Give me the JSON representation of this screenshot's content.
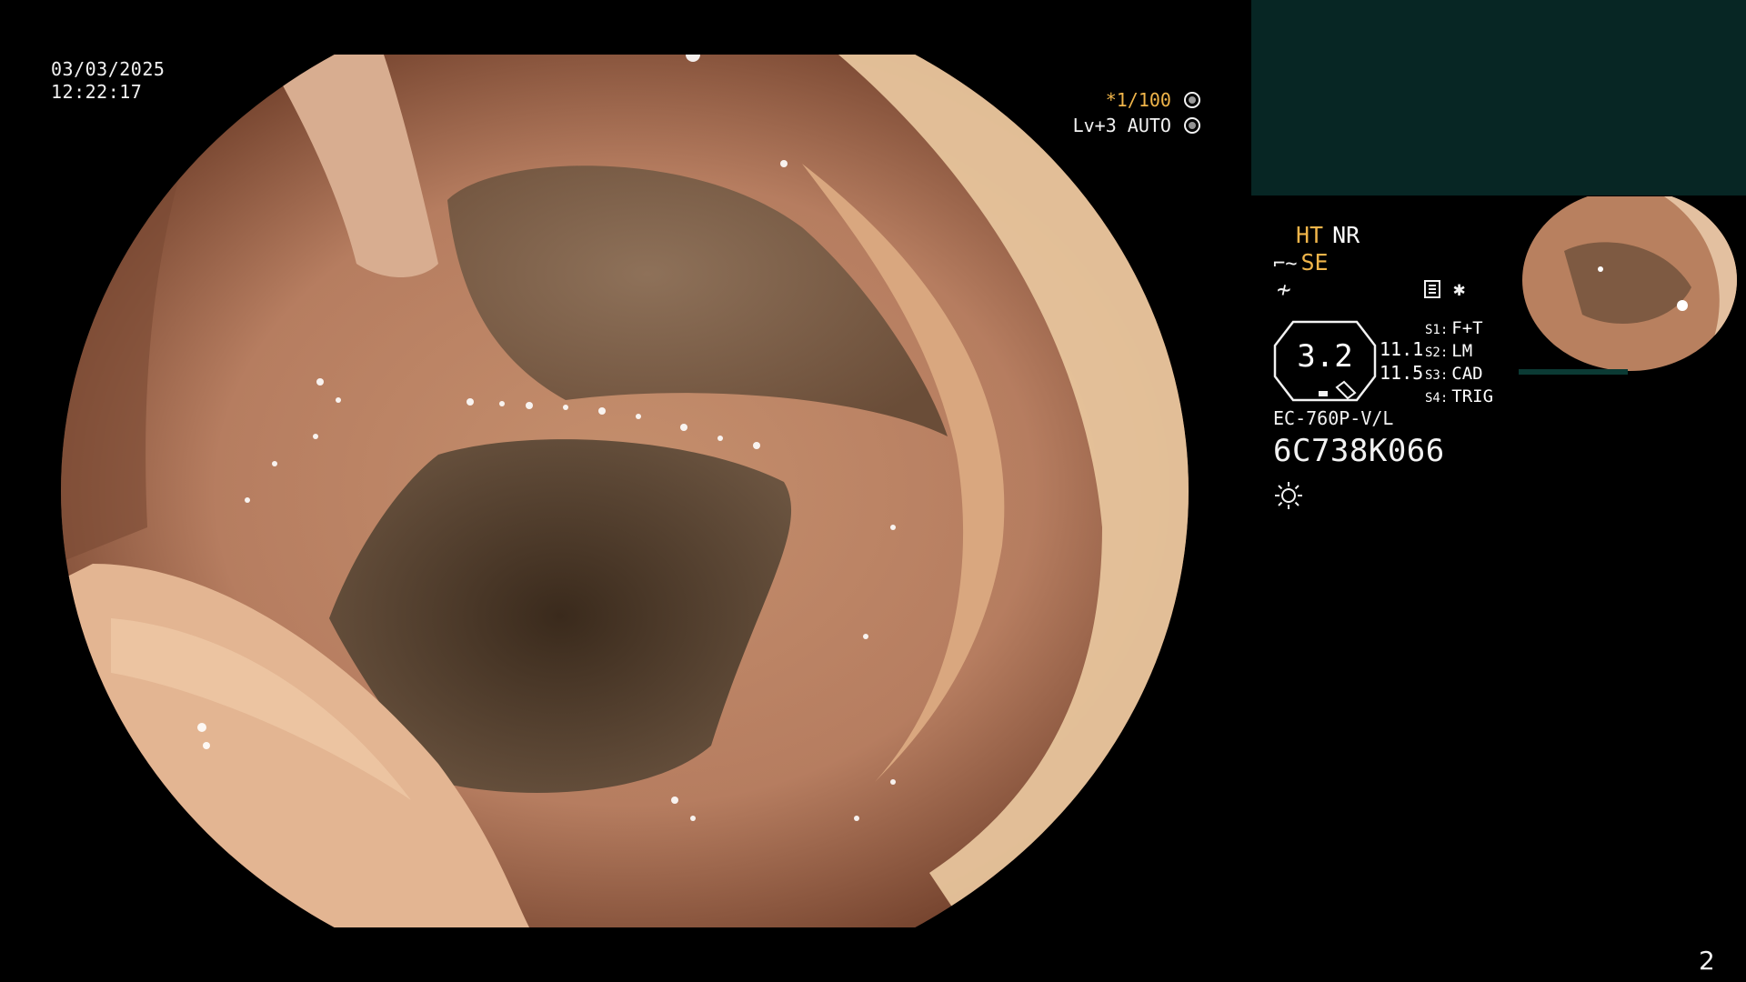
{
  "overlay": {
    "date": "03/03/2025",
    "time": "12:22:17",
    "shutter": "*1/100",
    "level": "Lv+3 AUTO"
  },
  "info": {
    "ht": "HT",
    "nr": "NR",
    "se": "SE",
    "magnification": "3.2",
    "value1": "11.1",
    "value2": "11.5",
    "switches": [
      {
        "key": "S1:",
        "label": "F+T"
      },
      {
        "key": "S2:",
        "label": "LM"
      },
      {
        "key": "S3:",
        "label": "CAD"
      },
      {
        "key": "S4:",
        "label": "TRIG"
      }
    ],
    "model": "EC-760P-V/L",
    "serial": "6C738K066"
  },
  "page_number": "2",
  "icons": [
    "aperture-icon",
    "color-enhance-icon",
    "list-icon",
    "star-icon",
    "octagon-gauge-icon",
    "light-icon"
  ],
  "colors": {
    "accent": "#f0b54a",
    "panel": "#072624"
  }
}
